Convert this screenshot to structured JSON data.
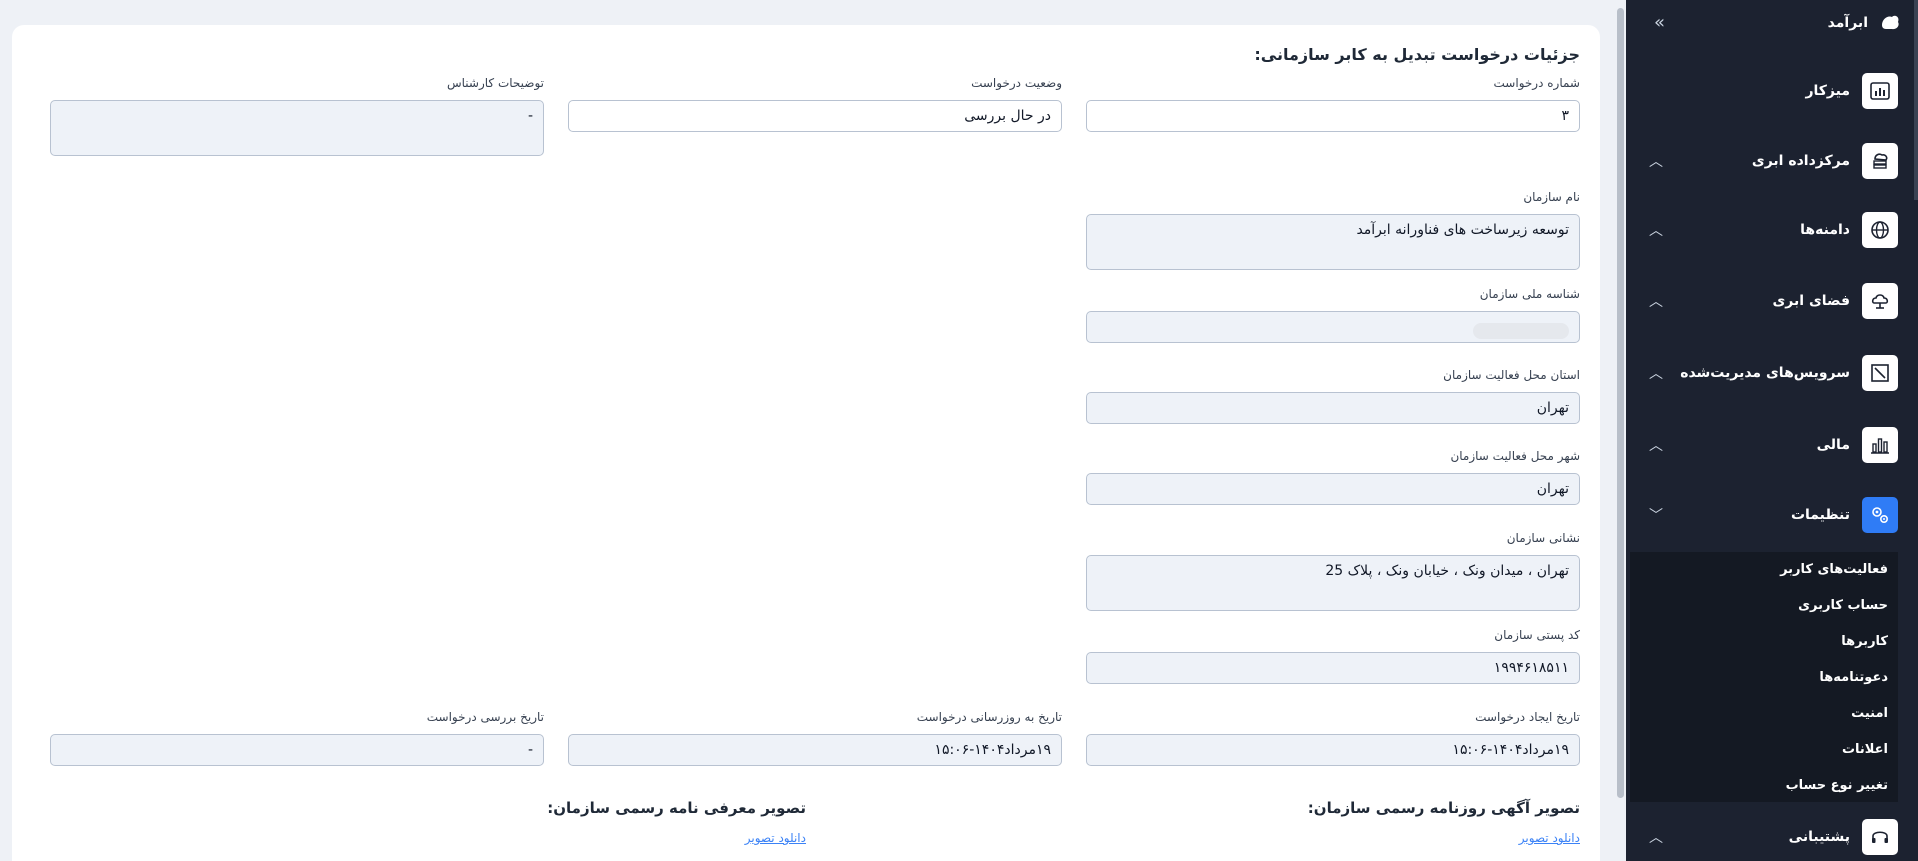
{
  "page": {
    "title": "جزئیات درخواست تبدیل به کابر سازمانی:"
  },
  "fields": {
    "request_number": {
      "label": "شماره درخواست",
      "value": "۳"
    },
    "request_status": {
      "label": "وضعیت درخواست",
      "value": "در حال بررسی"
    },
    "expert_notes": {
      "label": "توضیحات کارشناس",
      "value": "-"
    },
    "org_name": {
      "label": "نام سازمان",
      "value": "توسعه زیرساخت های فناورانه ابرآمد"
    },
    "national_id": {
      "label": "شناسه ملی سازمان",
      "value": ""
    },
    "province": {
      "label": "استان محل فعالیت سازمان",
      "value": "تهران"
    },
    "city": {
      "label": "شهر محل فعالیت سازمان",
      "value": "تهران"
    },
    "address": {
      "label": "نشانی سازمان",
      "value": "تهران ، میدان ونک ، خیابان ونک ، پلاک 25"
    },
    "postal_code": {
      "label": "کد پستی سازمان",
      "value": "۱۹۹۴۶۱۸۵۱۱"
    },
    "created_at": {
      "label": "تاریخ ایجاد درخواست",
      "value": "۱۹مرداد۱۴۰۴-۱۵:۰۶"
    },
    "updated_at": {
      "label": "تاریخ به روزرسانی درخواست",
      "value": "۱۹مرداد۱۴۰۴-۱۵:۰۶"
    },
    "reviewed_at": {
      "label": "تاریخ بررسی درخواست",
      "value": "-"
    }
  },
  "documents": {
    "gazette": {
      "title": "تصویر آگهی روزنامه رسمی سازمان:",
      "link": "دانلود تصویر"
    },
    "intro_letter": {
      "title": "تصویر معرفی نامه رسمی سازمان:",
      "link": "دانلود تصویر"
    }
  },
  "sidebar": {
    "brand": "ابرآمد",
    "items": [
      {
        "label": "میزکار",
        "icon": "dashboard-chart-icon",
        "chevron": ""
      },
      {
        "label": "مرکزداده ابری",
        "icon": "datacenter-icon",
        "chevron": "^"
      },
      {
        "label": "دامنه‌ها",
        "icon": "globe-icon",
        "chevron": "^"
      },
      {
        "label": "فضای ابری",
        "icon": "cloud-storage-icon",
        "chevron": "^"
      },
      {
        "label": "سرویس‌های مدیریت‌شده",
        "icon": "managed-services-icon",
        "chevron": "^"
      },
      {
        "label": "مالی",
        "icon": "finance-chart-icon",
        "chevron": "^"
      },
      {
        "label": "تنظیمات",
        "icon": "settings-gears-icon",
        "chevron": "v"
      },
      {
        "label": "پشتیبانی",
        "icon": "headset-icon",
        "chevron": "^"
      }
    ],
    "settings_submenu": [
      "فعالیت‌های کاربر",
      "حساب کاربری",
      "کاربرها",
      "دعوتنامه‌ها",
      "امنیت",
      "اعلانات",
      "تغییر نوع حساب"
    ]
  },
  "colors": {
    "sidebar_bg": "#1c2230",
    "accent": "#2f7cf6",
    "link": "#3b82f6",
    "page_bg": "#eef1f6"
  }
}
